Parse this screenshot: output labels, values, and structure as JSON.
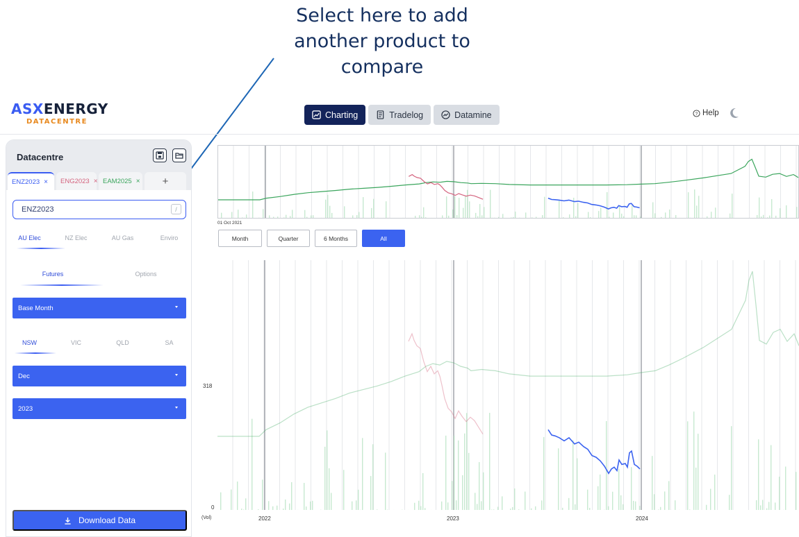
{
  "callout": {
    "line1": "Select here to add",
    "line2": "another product to",
    "line3": "compare"
  },
  "logo": {
    "part1": "ASX",
    "part2": "ENERGY",
    "sub": "DATACENTRE"
  },
  "nav": [
    {
      "label": "Charting",
      "icon": "chart-icon",
      "active": true
    },
    {
      "label": "Tradelog",
      "icon": "document-icon",
      "active": false
    },
    {
      "label": "Datamine",
      "icon": "trend-icon",
      "active": false
    }
  ],
  "help": {
    "label": "Help",
    "icon": "help-circle-icon"
  },
  "sidebar": {
    "title": "Datacentre",
    "tabs": [
      {
        "label": "ENZ2023",
        "color": "#3a5cf2",
        "active": true
      },
      {
        "label": "ENG2023",
        "color": "#d4637e",
        "active": false
      },
      {
        "label": "EAM2025",
        "color": "#3aa55c",
        "active": false
      }
    ],
    "close_glyph": "×",
    "add_glyph": "+",
    "product_input": {
      "value": "ENZ2023",
      "shortcut": "/"
    },
    "markets": [
      "AU Elec",
      "NZ Elec",
      "AU Gas",
      "Enviro"
    ],
    "market_selected": "AU Elec",
    "types": [
      "Futures",
      "Options"
    ],
    "type_selected": "Futures",
    "contract_dropdown": "Base Month",
    "regions": [
      "NSW",
      "VIC",
      "QLD",
      "SA"
    ],
    "region_selected": "NSW",
    "month_dropdown": "Dec",
    "year_dropdown": "2023",
    "download_label": "Download Data"
  },
  "overview": {
    "start_label": "01 Oct 2021"
  },
  "ranges": [
    {
      "label": "Month",
      "active": false
    },
    {
      "label": "Quarter",
      "active": false
    },
    {
      "label": "6 Months",
      "active": false
    },
    {
      "label": "All",
      "active": true
    }
  ],
  "chart_data": {
    "type": "line",
    "y_ticks": [
      "318",
      "0"
    ],
    "y_prefix": "(Vol)",
    "x_ticks": [
      "2022",
      "2023",
      "2024"
    ],
    "ylim": [
      0,
      560
    ],
    "series": [
      {
        "color": "#3aa55c",
        "x": [
          0,
          20,
          40,
          60,
          70,
          90,
          110,
          130,
          150,
          170,
          190,
          210,
          230,
          250,
          270,
          280,
          290,
          300,
          310,
          320,
          330,
          340,
          350,
          360,
          365,
          380,
          400,
          420,
          450,
          480,
          520,
          560,
          590,
          610,
          630,
          650,
          670,
          700,
          720,
          740,
          760,
          765,
          770,
          775,
          780,
          790,
          800,
          810,
          820,
          830,
          837
        ],
        "y": [
          165,
          165,
          165,
          165,
          180,
          195,
          215,
          230,
          240,
          250,
          262,
          270,
          278,
          288,
          300,
          305,
          310,
          322,
          328,
          325,
          333,
          330,
          322,
          318,
          312,
          315,
          312,
          305,
          300,
          300,
          300,
          300,
          303,
          308,
          312,
          325,
          340,
          365,
          385,
          405,
          470,
          515,
          535,
          460,
          380,
          372,
          398,
          405,
          378,
          395,
          368
        ]
      },
      {
        "color": "#d4637e",
        "x": [
          275,
          280,
          283,
          287,
          292,
          297,
          302,
          307,
          312,
          317,
          320,
          323,
          327,
          332,
          337,
          342,
          347,
          352,
          358,
          364,
          370,
          376,
          382
        ],
        "y": [
          378,
          395,
          380,
          368,
          362,
          332,
          310,
          322,
          305,
          312,
          300,
          280,
          250,
          228,
          220,
          205,
          222,
          210,
          198,
          208,
          200,
          185,
          170
        ]
      },
      {
        "color": "#3b63f0",
        "x": [
          476,
          481,
          486,
          492,
          499,
          506,
          514,
          520,
          527,
          533,
          539,
          545,
          551,
          557,
          563,
          567,
          571,
          575,
          578,
          582,
          587,
          590,
          593,
          596,
          600,
          604,
          608
        ],
        "y": [
          180,
          168,
          166,
          162,
          155,
          162,
          148,
          152,
          142,
          136,
          122,
          118,
          110,
          98,
          82,
          92,
          96,
          88,
          112,
          102,
          104,
          96,
          128,
          132,
          102,
          98,
          92
        ]
      }
    ]
  }
}
